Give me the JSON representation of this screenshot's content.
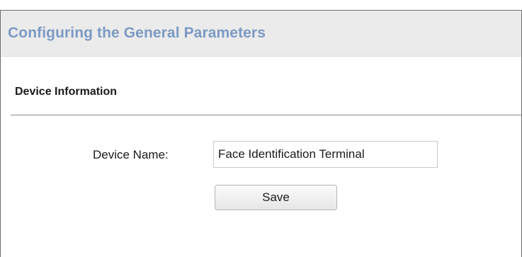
{
  "header": {
    "title": "Configuring the General Parameters"
  },
  "section": {
    "title": "Device Information"
  },
  "form": {
    "device_name_label": "Device Name:",
    "device_name_value": "Face Identification Terminal",
    "save_label": "Save"
  },
  "colors": {
    "title_text": "#7b9ac4",
    "title_bar_bg": "#ebebeb",
    "divider": "#8a8a8a"
  }
}
